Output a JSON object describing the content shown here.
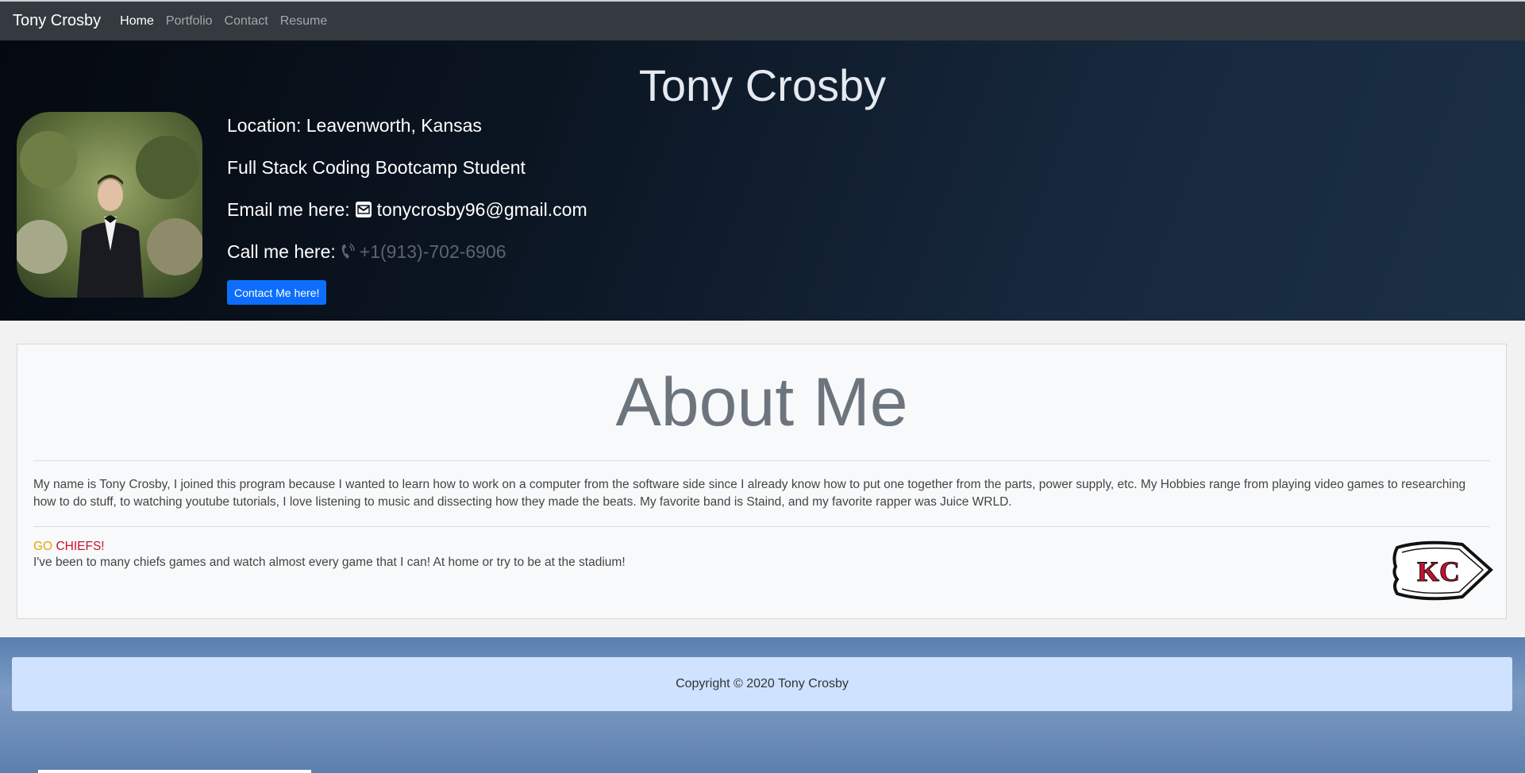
{
  "navbar": {
    "brand": "Tony Crosby",
    "links": [
      "Home",
      "Portfolio",
      "Contact",
      "Resume"
    ]
  },
  "hero": {
    "title": "Tony Crosby",
    "location": "Location: Leavenworth, Kansas",
    "role": "Full Stack Coding Bootcamp Student",
    "email_label": "Email me here:",
    "email": "tonycrosby96@gmail.com",
    "phone_label": "Call me here:",
    "phone": "+1(913)-702-6906",
    "button": "Contact Me here!"
  },
  "about": {
    "title": "About Me",
    "text": "My name is Tony Crosby, I joined this program because I wanted to learn how to work on a computer from the software side since I already know how to put one together from the parts, power supply, etc. My Hobbies range from playing video games to researching how to do stuff, to watching youtube tutorials, I love listening to music and dissecting how they made the beats. My favorite band is Staind, and my favorite rapper was Juice WRLD.",
    "chiefs_go": "GO",
    "chiefs_name": "CHIEFS!",
    "chiefs_text": "I've been to many chiefs games and watch almost every game that I can! At home or try to be at the stadium!",
    "logo_text": "KC"
  },
  "footer": {
    "copyright": "Copyright © 2020 Tony Crosby"
  },
  "icons": {
    "email": "envelope-icon",
    "phone": "phone-icon"
  },
  "colors": {
    "navbar": "#343a40",
    "button": "#0d6efd",
    "chiefs_gold": "#e6a600",
    "chiefs_red": "#c8102e",
    "footer": "#cfe2ff"
  }
}
